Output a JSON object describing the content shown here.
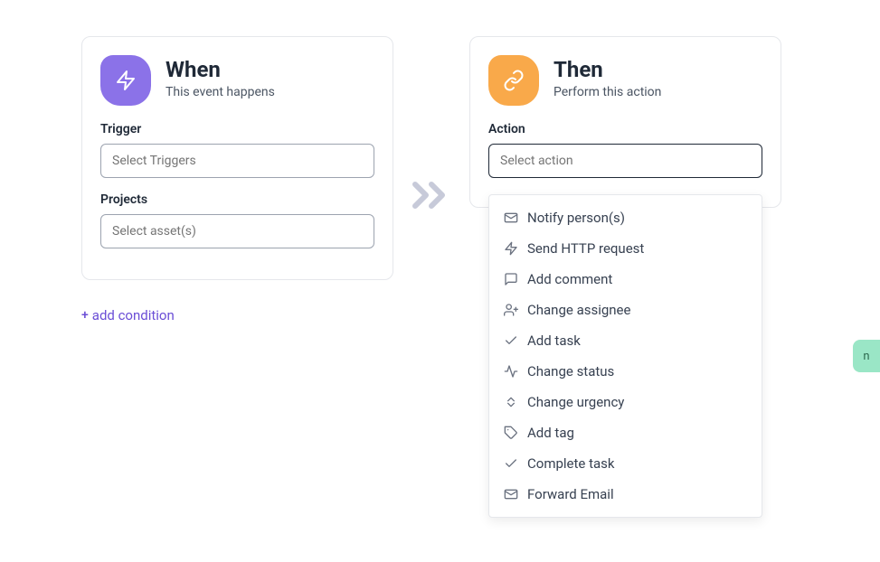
{
  "when": {
    "title": "When",
    "subtitle": "This event happens",
    "trigger_label": "Trigger",
    "trigger_placeholder": "Select Triggers",
    "projects_label": "Projects",
    "projects_placeholder": "Select asset(s)"
  },
  "then": {
    "title": "Then",
    "subtitle": "Perform this action",
    "action_label": "Action",
    "action_placeholder": "Select action"
  },
  "add_condition_label": "add condition",
  "actions": [
    {
      "icon": "mail",
      "label": "Notify person(s)"
    },
    {
      "icon": "bolt",
      "label": "Send HTTP request"
    },
    {
      "icon": "comment",
      "label": "Add comment"
    },
    {
      "icon": "user-plus",
      "label": "Change assignee"
    },
    {
      "icon": "check",
      "label": "Add task"
    },
    {
      "icon": "activity",
      "label": "Change status"
    },
    {
      "icon": "updown",
      "label": "Change urgency"
    },
    {
      "icon": "tag",
      "label": "Add tag"
    },
    {
      "icon": "check",
      "label": "Complete task"
    },
    {
      "icon": "mail",
      "label": "Forward Email"
    }
  ],
  "bg_pill_text": "n"
}
